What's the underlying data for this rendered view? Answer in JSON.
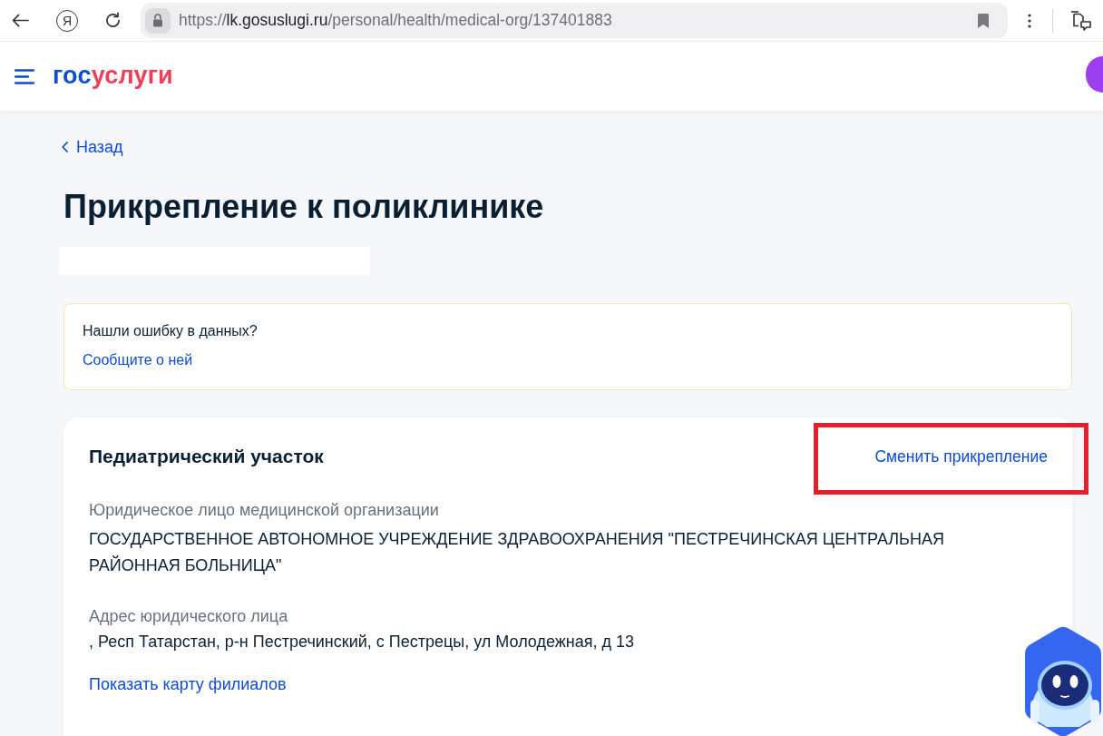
{
  "browser": {
    "logo_button": "Я",
    "url": {
      "scheme": "https://",
      "host": "lk.gosuslugi.ru",
      "path": "/personal/health/medical-org/137401883"
    }
  },
  "header": {
    "logo": [
      {
        "text": "гос",
        "color": "#0d4cd3"
      },
      {
        "text": "услуги",
        "color": "#ee3f58"
      }
    ]
  },
  "back_link": "Назад",
  "title": "Прикрепление к поликлинике",
  "notice": {
    "question": "Нашли ошибку в данных?",
    "link": "Сообщите о ней"
  },
  "card": {
    "title": "Педиатрический участок",
    "change_link": {
      "label": "Сменить прикрепление",
      "highlighted": true
    },
    "fields": [
      {
        "label": "Юридическое лицо медицинской организации",
        "value": "ГОСУДАРСТВЕННОЕ АВТОНОМНОЕ УЧРЕЖДЕНИЕ ЗДРАВООХРАНЕНИЯ \"ПЕСТРЕЧИНСКАЯ ЦЕНТРАЛЬНАЯ РАЙОННАЯ БОЛЬНИЦА\""
      },
      {
        "label": "Адрес юридического лица",
        "value": ", Респ Татарстан, р-н Пестречинский, с Пестрецы, ул Молодежная, д 13"
      }
    ],
    "map_link": "Показать карту филиалов"
  }
}
